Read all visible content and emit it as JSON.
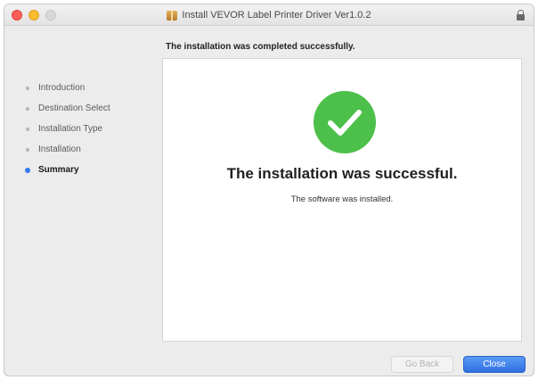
{
  "window": {
    "title": "Install VEVOR Label Printer Driver Ver1.0.2"
  },
  "header_message": "The installation was completed successfully.",
  "sidebar": {
    "steps": [
      {
        "label": "Introduction"
      },
      {
        "label": "Destination Select"
      },
      {
        "label": "Installation Type"
      },
      {
        "label": "Installation"
      },
      {
        "label": "Summary",
        "active": true
      }
    ]
  },
  "main": {
    "title": "The installation was successful.",
    "subtitle": "The software was installed.",
    "icon": "success-checkmark-icon",
    "icon_color": "#4cc04a"
  },
  "buttons": {
    "go_back": "Go Back",
    "close": "Close"
  },
  "colors": {
    "accent": "#3478f6",
    "close_button": "#3b7ae8",
    "success": "#4cc04a"
  }
}
